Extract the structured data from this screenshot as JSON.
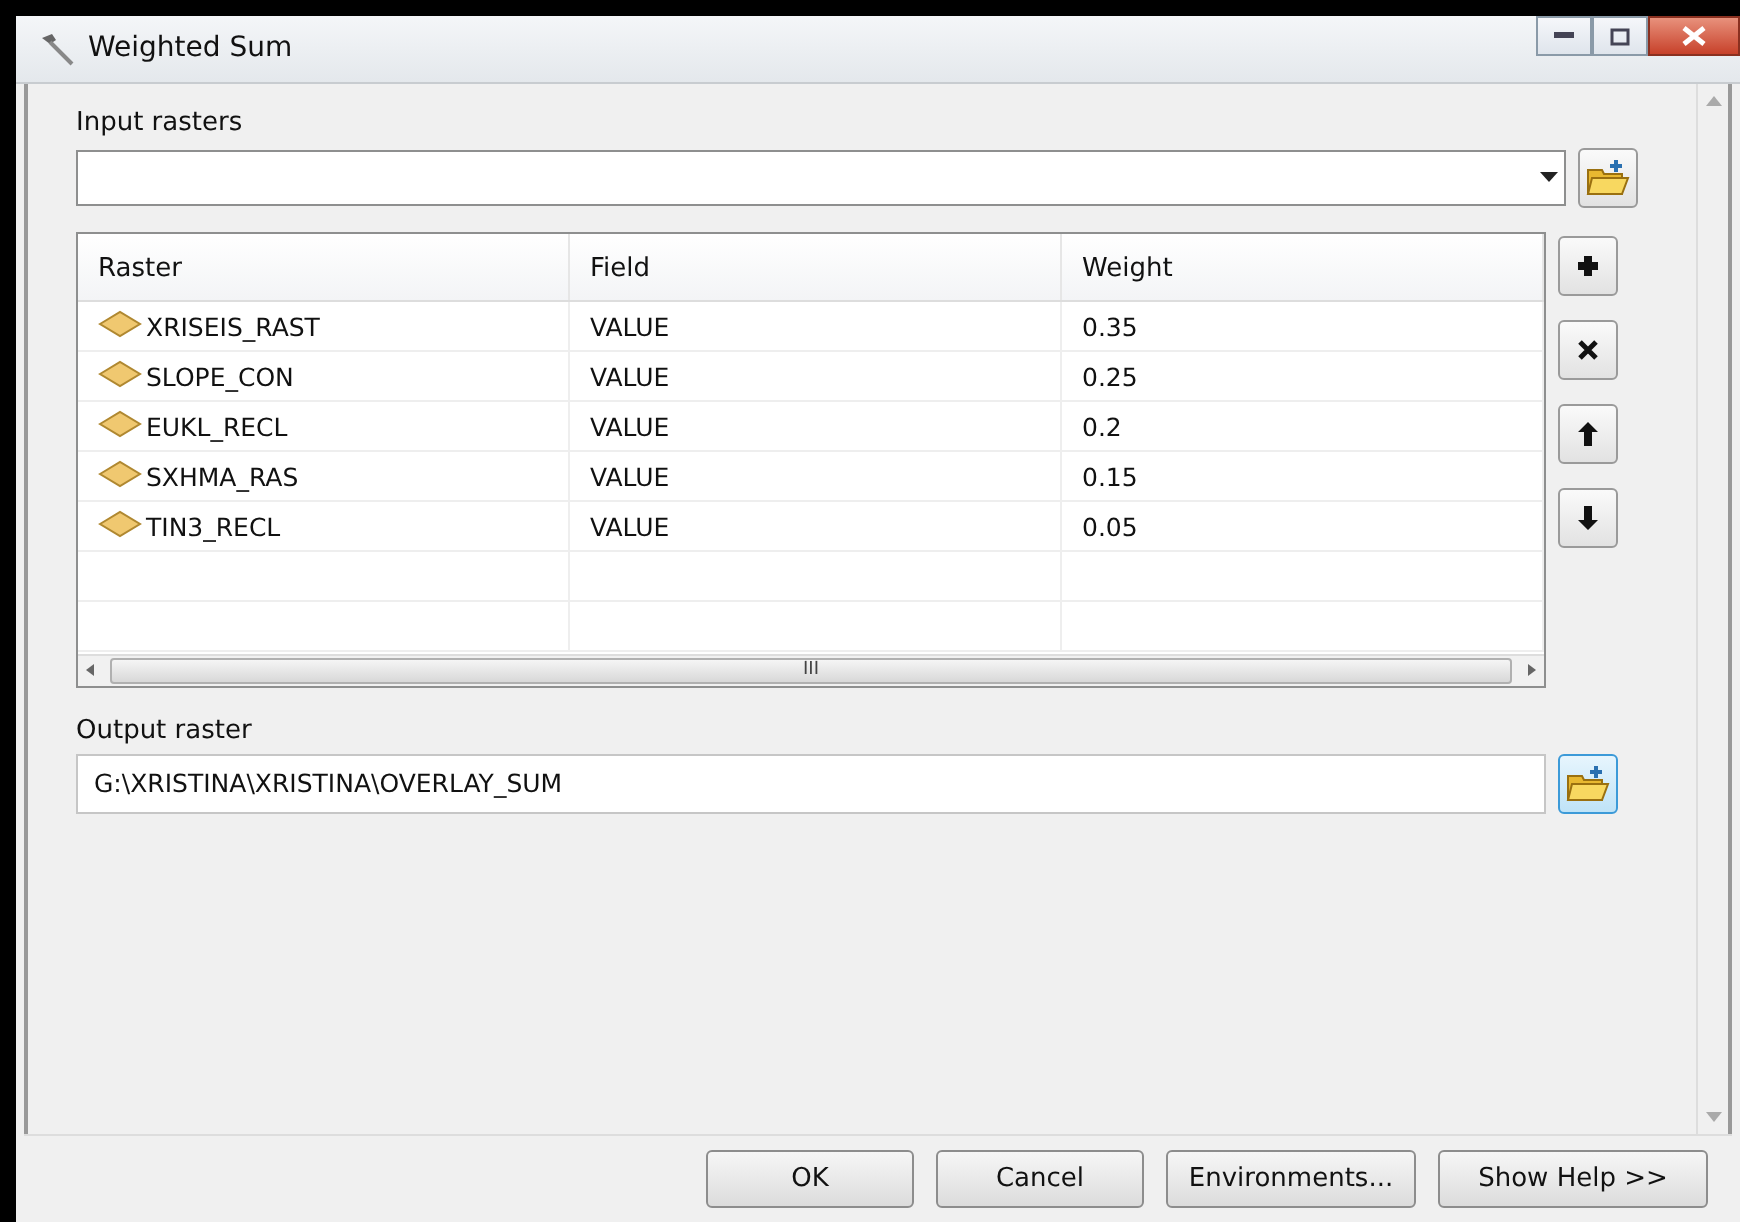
{
  "window": {
    "title": "Weighted Sum"
  },
  "input_rasters": {
    "label": "Input rasters"
  },
  "table": {
    "columns": [
      "Raster",
      "Field",
      "Weight"
    ],
    "rows": [
      {
        "raster": "XRISEIS_RAST",
        "field": "VALUE",
        "weight": "0.35"
      },
      {
        "raster": "SLOPE_CON",
        "field": "VALUE",
        "weight": "0.25"
      },
      {
        "raster": "EUKL_RECL",
        "field": "VALUE",
        "weight": "0.2"
      },
      {
        "raster": "SXHMA_RAS",
        "field": "VALUE",
        "weight": "0.15"
      },
      {
        "raster": "TIN3_RECL",
        "field": "VALUE",
        "weight": "0.05"
      }
    ],
    "scroll_thumb": "III"
  },
  "side_buttons": [
    {
      "kind": "add"
    },
    {
      "kind": "remove"
    },
    {
      "kind": "up"
    },
    {
      "kind": "down"
    }
  ],
  "output_raster": {
    "label": "Output raster",
    "value": "G:\\XRISTINA\\XRISTINA\\OVERLAY_SUM"
  },
  "buttons": [
    "OK",
    "Cancel",
    "Environments...",
    "Show Help >>"
  ]
}
